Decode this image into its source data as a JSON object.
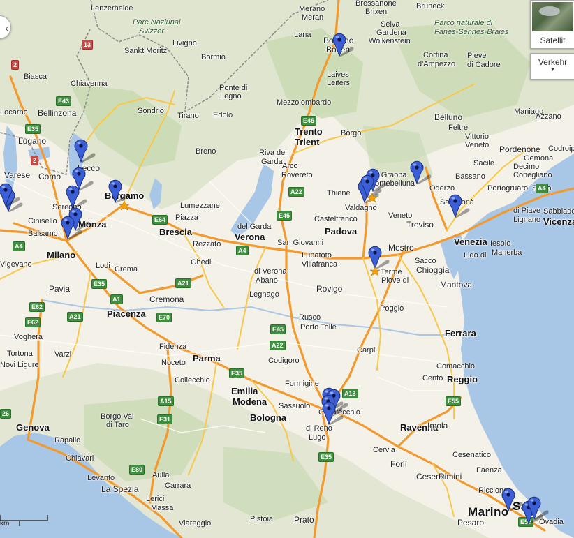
{
  "map": {
    "controls": {
      "satellite_label": "Satellit",
      "traffic_label": "Verkehr",
      "traffic_caret": "▾",
      "pan_glyph": "‹",
      "scale_unit": "km"
    },
    "labels": [
      {
        "text": "Lenzerheide",
        "size": "s"
      },
      {
        "text": "Parc Naziunal",
        "size": "park"
      },
      {
        "text": "Svizzer",
        "size": "park"
      },
      {
        "text": "Sankt Moritz",
        "size": "s"
      },
      {
        "text": "Livigno",
        "size": "s"
      },
      {
        "text": "Bormio",
        "size": "s"
      },
      {
        "text": "Chiavenna",
        "size": "s"
      },
      {
        "text": "Bellinzona",
        "size": "m"
      },
      {
        "text": "Locarno",
        "size": "s"
      },
      {
        "text": "Biasca",
        "size": "s"
      },
      {
        "text": "Lugano",
        "size": "m"
      },
      {
        "text": "Sondrio",
        "size": "s"
      },
      {
        "text": "Tirano",
        "size": "s"
      },
      {
        "text": "Edolo",
        "size": "s"
      },
      {
        "text": "Lecco",
        "size": "m"
      },
      {
        "text": "Como",
        "size": "m"
      },
      {
        "text": "Varese",
        "size": "m"
      },
      {
        "text": "Seregno",
        "size": "s"
      },
      {
        "text": "Monza",
        "size": "l"
      },
      {
        "text": "Cinisello",
        "size": "s"
      },
      {
        "text": "Balsamo",
        "size": "s"
      },
      {
        "text": "Milano",
        "size": "l"
      },
      {
        "text": "Bergamo",
        "size": "l"
      },
      {
        "text": "Lumezzane",
        "size": "s"
      },
      {
        "text": "Brescia",
        "size": "l"
      },
      {
        "text": "Piazza",
        "size": "s"
      },
      {
        "text": "Rezzato",
        "size": "s"
      },
      {
        "text": "Ghedi",
        "size": "s"
      },
      {
        "text": "Vigevano",
        "size": "s"
      },
      {
        "text": "Lodi",
        "size": "s"
      },
      {
        "text": "Crema",
        "size": "s"
      },
      {
        "text": "Pavia",
        "size": "m"
      },
      {
        "text": "Cremona",
        "size": "m"
      },
      {
        "text": "Piacenza",
        "size": "l"
      },
      {
        "text": "Voghera",
        "size": "s"
      },
      {
        "text": "Tortona",
        "size": "s"
      },
      {
        "text": "Varzi",
        "size": "s"
      },
      {
        "text": "Novi Ligure",
        "size": "s"
      },
      {
        "text": "Fidenza",
        "size": "s"
      },
      {
        "text": "Noceto",
        "size": "s"
      },
      {
        "text": "Parma",
        "size": "l"
      },
      {
        "text": "Collecchio",
        "size": "s"
      },
      {
        "text": "Borgo Val",
        "size": "s"
      },
      {
        "text": "di Taro",
        "size": "s"
      },
      {
        "text": "Genova",
        "size": "l"
      },
      {
        "text": "Rapallo",
        "size": "s"
      },
      {
        "text": "Chiavari",
        "size": "s"
      },
      {
        "text": "Levanto",
        "size": "s"
      },
      {
        "text": "La Spezia",
        "size": "m"
      },
      {
        "text": "Aulla",
        "size": "s"
      },
      {
        "text": "Carrara",
        "size": "s"
      },
      {
        "text": "Lerici",
        "size": "s"
      },
      {
        "text": "Massa",
        "size": "s"
      },
      {
        "text": "Viareggio",
        "size": "s"
      },
      {
        "text": "Pistoia",
        "size": "s"
      },
      {
        "text": "Prato",
        "size": "m"
      },
      {
        "text": "Merano",
        "size": "s"
      },
      {
        "text": "Meran",
        "size": "s"
      },
      {
        "text": "Bolzano",
        "size": "m"
      },
      {
        "text": "Bozen",
        "size": "m"
      },
      {
        "text": "Lana",
        "size": "s"
      },
      {
        "text": "Laives",
        "size": "s"
      },
      {
        "text": "Leifers",
        "size": "s"
      },
      {
        "text": "Bressanone",
        "size": "s"
      },
      {
        "text": "Brixen",
        "size": "s"
      },
      {
        "text": "Selva",
        "size": "s"
      },
      {
        "text": "Gardena",
        "size": "s"
      },
      {
        "text": "Wolkenstein",
        "size": "s"
      },
      {
        "text": "Bruneck",
        "size": "s"
      },
      {
        "text": "Parco naturale di",
        "size": "park"
      },
      {
        "text": "Fanes-Sennes-Braies",
        "size": "park"
      },
      {
        "text": "Cortina",
        "size": "s"
      },
      {
        "text": "d'Ampezzo",
        "size": "s"
      },
      {
        "text": "Pieve",
        "size": "s"
      },
      {
        "text": "di Cadore",
        "size": "s"
      },
      {
        "text": "Mezzolombardo",
        "size": "s"
      },
      {
        "text": "Trento",
        "size": "l"
      },
      {
        "text": "Trient",
        "size": "l"
      },
      {
        "text": "Borgo",
        "size": "s"
      },
      {
        "text": "Riva del",
        "size": "s"
      },
      {
        "text": "Garda",
        "size": "s"
      },
      {
        "text": "Arco",
        "size": "s"
      },
      {
        "text": "Rovereto",
        "size": "s"
      },
      {
        "text": "Ponte di",
        "size": "s"
      },
      {
        "text": "Legno",
        "size": "s"
      },
      {
        "text": "Breno",
        "size": "s"
      },
      {
        "text": "Belluno",
        "size": "m"
      },
      {
        "text": "Feltre",
        "size": "s"
      },
      {
        "text": "Maniago",
        "size": "s"
      },
      {
        "text": "Vittorio",
        "size": "s"
      },
      {
        "text": "Veneto",
        "size": "s"
      },
      {
        "text": "Sacile",
        "size": "s"
      },
      {
        "text": "Pordenone",
        "size": "m"
      },
      {
        "text": "Codroipo",
        "size": "s"
      },
      {
        "text": "Gemona",
        "size": "s"
      },
      {
        "text": "Azzano",
        "size": "s"
      },
      {
        "text": "Decimo",
        "size": "s"
      },
      {
        "text": "Conegliano",
        "size": "s"
      },
      {
        "text": "Bassano",
        "size": "s"
      },
      {
        "text": "del Grappa",
        "size": "s"
      },
      {
        "text": "Montebelluna",
        "size": "s"
      },
      {
        "text": "Oderzo",
        "size": "s"
      },
      {
        "text": "Portogruaro",
        "size": "s"
      },
      {
        "text": "Schio",
        "size": "s"
      },
      {
        "text": "Thiene",
        "size": "s"
      },
      {
        "text": "Valdagno",
        "size": "s"
      },
      {
        "text": "Castelfranco",
        "size": "s"
      },
      {
        "text": "Veneto",
        "size": "s"
      },
      {
        "text": "Treviso",
        "size": "m"
      },
      {
        "text": "San Donà",
        "size": "s"
      },
      {
        "text": "di Piave",
        "size": "s"
      },
      {
        "text": "Lignano",
        "size": "s"
      },
      {
        "text": "Sabbiadoro",
        "size": "s"
      },
      {
        "text": "Vicenza",
        "size": "l"
      },
      {
        "text": "Padova",
        "size": "l"
      },
      {
        "text": "Mestre",
        "size": "m"
      },
      {
        "text": "Venezia",
        "size": "l"
      },
      {
        "text": "Lido di",
        "size": "s"
      },
      {
        "text": "Iesolo",
        "size": "s"
      },
      {
        "text": "Manerba",
        "size": "s"
      },
      {
        "text": "del Garda",
        "size": "s"
      },
      {
        "text": "Verona",
        "size": "l"
      },
      {
        "text": "San Giovanni",
        "size": "s"
      },
      {
        "text": "Lupatoto",
        "size": "s"
      },
      {
        "text": "Villafranca",
        "size": "s"
      },
      {
        "text": "di Verona",
        "size": "s"
      },
      {
        "text": "Abano",
        "size": "s"
      },
      {
        "text": "Terme",
        "size": "s"
      },
      {
        "text": "Piove di",
        "size": "s"
      },
      {
        "text": "Sacco",
        "size": "s"
      },
      {
        "text": "Chioggia",
        "size": "m"
      },
      {
        "text": "Mantova",
        "size": "m"
      },
      {
        "text": "Legnago",
        "size": "s"
      },
      {
        "text": "Rovigo",
        "size": "m"
      },
      {
        "text": "Poggio",
        "size": "s"
      },
      {
        "text": "Rusco",
        "size": "s"
      },
      {
        "text": "Porto Tolle",
        "size": "s"
      },
      {
        "text": "Ferrara",
        "size": "l"
      },
      {
        "text": "Carpi",
        "size": "s"
      },
      {
        "text": "Codigoro",
        "size": "s"
      },
      {
        "text": "Comacchio",
        "size": "s"
      },
      {
        "text": "Cento",
        "size": "s"
      },
      {
        "text": "Reggio",
        "size": "l"
      },
      {
        "text": "Emilia",
        "size": "l"
      },
      {
        "text": "Modena",
        "size": "l"
      },
      {
        "text": "Formigine",
        "size": "s"
      },
      {
        "text": "Sassuolo",
        "size": "s"
      },
      {
        "text": "Bologna",
        "size": "l"
      },
      {
        "text": "Casalecchio",
        "size": "s"
      },
      {
        "text": "di Reno",
        "size": "s"
      },
      {
        "text": "Lugo",
        "size": "s"
      },
      {
        "text": "Ravenna",
        "size": "l"
      },
      {
        "text": "Imola",
        "size": "m"
      },
      {
        "text": "Cervia",
        "size": "s"
      },
      {
        "text": "Cesenatico",
        "size": "s"
      },
      {
        "text": "Faenza",
        "size": "s"
      },
      {
        "text": "Forlì",
        "size": "m"
      },
      {
        "text": "Cesena",
        "size": "m"
      },
      {
        "text": "Rimini",
        "size": "m"
      },
      {
        "text": "Riccione",
        "size": "s"
      },
      {
        "text": "San",
        "size": "xl"
      },
      {
        "text": "Marino",
        "size": "xl"
      },
      {
        "text": "Pesaro",
        "size": "m"
      },
      {
        "text": "Ovadia",
        "size": "s"
      }
    ],
    "shields": [
      {
        "text": "13",
        "kind": "red"
      },
      {
        "text": "2",
        "kind": "red"
      },
      {
        "text": "2",
        "kind": "red"
      },
      {
        "text": "E43",
        "kind": "green"
      },
      {
        "text": "E35",
        "kind": "green"
      },
      {
        "text": "E45",
        "kind": "green"
      },
      {
        "text": "A22",
        "kind": "green"
      },
      {
        "text": "E45",
        "kind": "green"
      },
      {
        "text": "A4",
        "kind": "green"
      },
      {
        "text": "E64",
        "kind": "green"
      },
      {
        "text": "A4",
        "kind": "green"
      },
      {
        "text": "A21",
        "kind": "green"
      },
      {
        "text": "E35",
        "kind": "green"
      },
      {
        "text": "A1",
        "kind": "green"
      },
      {
        "text": "E62",
        "kind": "green"
      },
      {
        "text": "A21",
        "kind": "green"
      },
      {
        "text": "E70",
        "kind": "green"
      },
      {
        "text": "E62",
        "kind": "green"
      },
      {
        "text": "A15",
        "kind": "green"
      },
      {
        "text": "E31",
        "kind": "green"
      },
      {
        "text": "E35",
        "kind": "green"
      },
      {
        "text": "E45",
        "kind": "green"
      },
      {
        "text": "A22",
        "kind": "green"
      },
      {
        "text": "A13",
        "kind": "green"
      },
      {
        "text": "E55",
        "kind": "green"
      },
      {
        "text": "E80",
        "kind": "green"
      },
      {
        "text": "E35",
        "kind": "green"
      },
      {
        "text": "E55",
        "kind": "green"
      },
      {
        "text": "A4",
        "kind": "green"
      },
      {
        "text": "26",
        "kind": "green"
      }
    ],
    "pins": [
      {
        "place": "Lecco"
      },
      {
        "place": "Como-Lecco"
      },
      {
        "place": "Seregno"
      },
      {
        "place": "Monza"
      },
      {
        "place": "Cinisello Balsamo"
      },
      {
        "place": "Bergamo"
      },
      {
        "place": "Busto"
      },
      {
        "place": "Varese"
      },
      {
        "place": "Bolzano"
      },
      {
        "place": "Schio"
      },
      {
        "place": "Bassano del Grappa"
      },
      {
        "place": "Thiene"
      },
      {
        "place": "Conegliano"
      },
      {
        "place": "Treviso"
      },
      {
        "place": "Abano Terme"
      },
      {
        "place": "Bologna 1"
      },
      {
        "place": "Bologna 2"
      },
      {
        "place": "Bologna 3"
      },
      {
        "place": "Casalecchio di Reno"
      },
      {
        "place": "Riccione"
      },
      {
        "place": "Cattolica 1"
      },
      {
        "place": "Cattolica 2"
      }
    ],
    "colors": {
      "land": "#f4f1e8",
      "sea": "#a8c6e6",
      "lake": "#a8c6e6",
      "forest": "#cfdfb9",
      "mountain": "#dfe4cf",
      "motorway": "#f29a2e",
      "primary_road": "#f7c84a",
      "border": "#8a8a8a",
      "pin": "#3b5fd6",
      "star": "#f4a300"
    }
  }
}
